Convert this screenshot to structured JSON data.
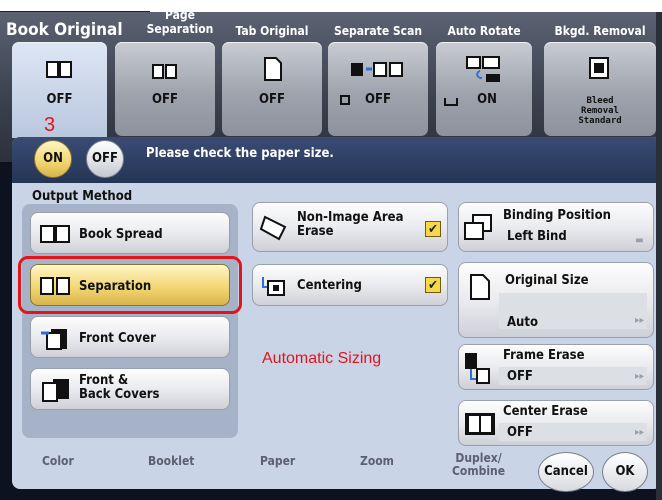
{
  "topbar": {
    "title": "Book Original"
  },
  "tabs": [
    {
      "header": "Page\nSeparation",
      "value": "OFF",
      "icon": "split-pages-icon"
    },
    {
      "header": "Tab Original",
      "value": "OFF",
      "icon": "tab-page-icon"
    },
    {
      "header": "Separate Scan",
      "value": "OFF",
      "icon": "separate-scan-icon"
    },
    {
      "header": "Auto Rotate",
      "value": "ON",
      "icon": "auto-rotate-icon"
    },
    {
      "header": "Bkgd. Removal",
      "value": "Bleed\nRemoval\nStandard",
      "icon": "bkgd-removal-icon"
    }
  ],
  "book_tile": {
    "value": "OFF",
    "icon": "book-icon"
  },
  "step_marker": "3",
  "toggle": {
    "on": "ON",
    "off": "OFF"
  },
  "message": "Please check the paper size.",
  "output_method": {
    "label": "Output Method",
    "options": [
      {
        "label": "Book Spread",
        "icon": "book-spread-icon"
      },
      {
        "label": "Separation",
        "icon": "separation-icon",
        "selected": true
      },
      {
        "label": "Front Cover",
        "icon": "front-cover-icon"
      },
      {
        "label": "Front &\nBack Covers",
        "icon": "front-back-covers-icon"
      }
    ]
  },
  "non_image_erase": {
    "label": "Non-Image Area\nErase",
    "checked": true
  },
  "centering": {
    "label": "Centering",
    "checked": true
  },
  "annotation": "Automatic Sizing",
  "binding_position": {
    "label": "Binding Position",
    "value": "Left Bind"
  },
  "original_size": {
    "label": "Original Size",
    "value": "Auto"
  },
  "frame_erase": {
    "label": "Frame Erase",
    "value": "OFF"
  },
  "center_erase": {
    "label": "Center Erase",
    "value": "OFF"
  },
  "bottom_tabs": [
    "Color",
    "Booklet",
    "Paper",
    "Zoom",
    "Duplex/\nCombine"
  ],
  "cancel_label": "Cancel",
  "ok_label": "OK",
  "colors": {
    "highlight": "#e0161c",
    "check": "#f7d848",
    "selected": "#f1d46e"
  }
}
